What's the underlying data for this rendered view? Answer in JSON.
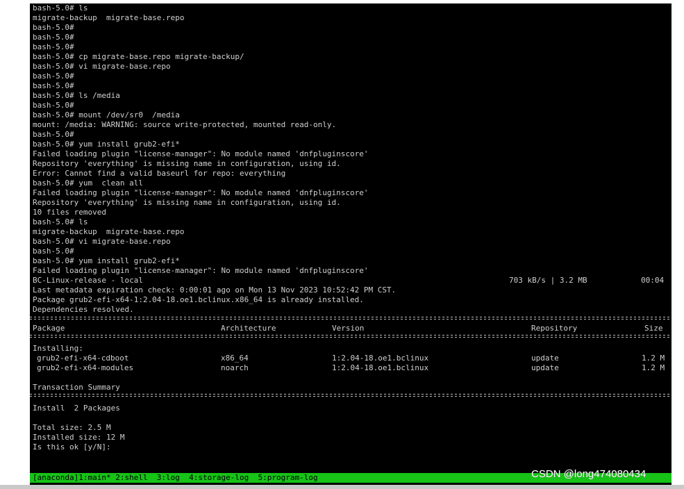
{
  "terminal": {
    "lines": [
      "bash-5.0# ls",
      "migrate-backup  migrate-base.repo",
      "bash-5.0#",
      "bash-5.0#",
      "bash-5.0#",
      "bash-5.0# cp migrate-base.repo migrate-backup/",
      "bash-5.0# vi migrate-base.repo",
      "bash-5.0#",
      "bash-5.0#",
      "bash-5.0# ls /media",
      "bash-5.0#",
      "bash-5.0# mount /dev/sr0  /media",
      "mount: /media: WARNING: source write-protected, mounted read-only.",
      "bash-5.0#",
      "bash-5.0# yum install grub2-efi*",
      "Failed loading plugin \"license-manager\": No module named 'dnfpluginscore'",
      "Repository 'everything' is missing name in configuration, using id.",
      "Error: Cannot find a valid baseurl for repo: everything",
      "bash-5.0# yum  clean all",
      "Failed loading plugin \"license-manager\": No module named 'dnfpluginscore'",
      "Repository 'everything' is missing name in configuration, using id.",
      "10 files removed",
      "bash-5.0# ls",
      "migrate-backup  migrate-base.repo",
      "bash-5.0# vi migrate-base.repo",
      "bash-5.0#",
      "bash-5.0# yum install grub2-efi*",
      "Failed loading plugin \"license-manager\": No module named 'dnfpluginscore'",
      "BC-Linux-release - local",
      "Last metadata expiration check: 0:00:01 ago on Mon 13 Nov 2023 10:52:42 PM CST.",
      "Package grub2-efi-x64-1:2.04-18.oe1.bclinux.x86_64 is already installed.",
      "Dependencies resolved."
    ],
    "download_speed": "703 kB/s | 3.2 MB",
    "download_time": "00:04",
    "table": {
      "headers": {
        "package": "Package",
        "architecture": "Architecture",
        "version": "Version",
        "repository": "Repository",
        "size": "Size"
      },
      "installing_label": "Installing:",
      "rows": [
        {
          "package": "grub2-efi-x64-cdboot",
          "arch": "x86_64",
          "version": "1:2.04-18.oe1.bclinux",
          "repo": "update",
          "size": "1.2 M"
        },
        {
          "package": "grub2-efi-x64-modules",
          "arch": "noarch",
          "version": "1:2.04-18.oe1.bclinux",
          "repo": "update",
          "size": "1.2 M"
        }
      ]
    },
    "summary": {
      "title": "Transaction Summary",
      "install_line": "Install  2 Packages",
      "total_size": "Total size: 2.5 M",
      "installed_size": "Installed size: 12 M",
      "prompt": "Is this ok [y/N]:"
    },
    "status_bar": {
      "tab1": "[anaconda]1:main* 2:shell  3:log  4:storage-log  5:program-log"
    }
  },
  "watermark": "CSDN @long474080434",
  "colors": {
    "background": "#000000",
    "text": "#d0d0d0",
    "highlight": "#3ef03e",
    "status_bar": "#17c317"
  }
}
